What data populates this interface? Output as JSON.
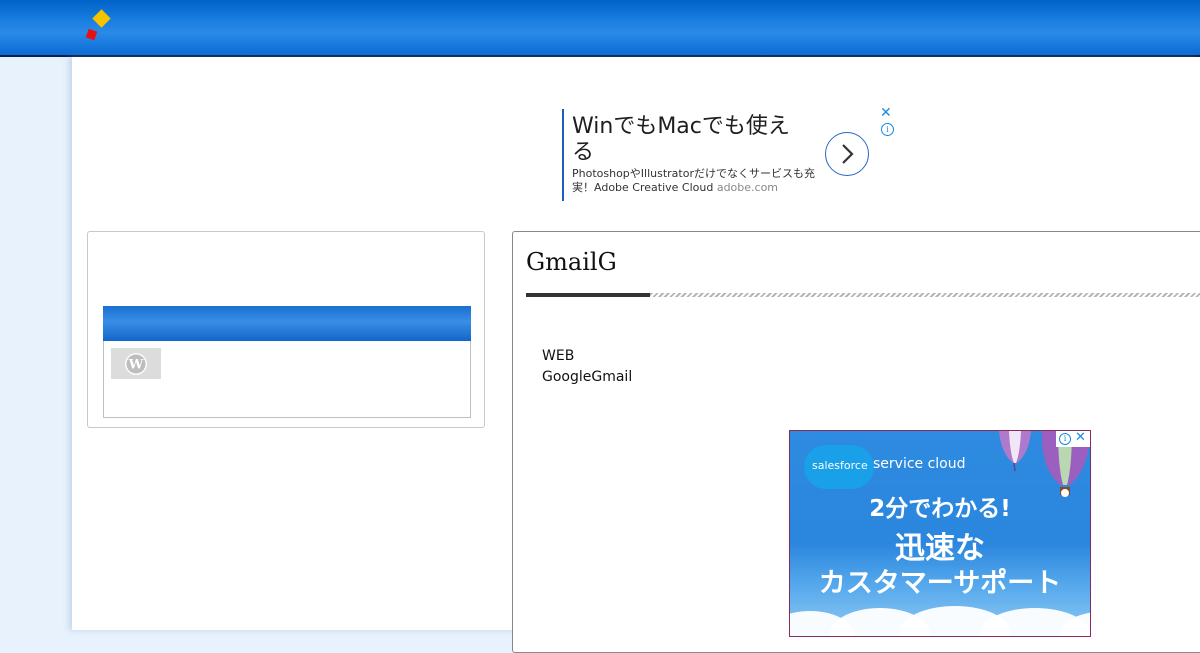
{
  "header": {
    "logo_icon": "diamond-logo-icon",
    "colors": {
      "bar": "#1a7fe0",
      "logo_yellow": "#f5c400",
      "logo_red": "#e81010"
    }
  },
  "top_ad": {
    "headline": "WinでもMacでも使える",
    "description": "PhotoshopやIllustratorだけでなくサービスも充実！Adobe Creative Cloud",
    "domain": "adobe.com",
    "close_icon": "close-icon",
    "info_icon": "info-icon",
    "arrow_icon": "chevron-right-icon",
    "close_glyph": "✕",
    "info_glyph": "i"
  },
  "sidebar": {
    "widget_icon": "wordpress-icon"
  },
  "article": {
    "title": "GmailG",
    "lines": [
      "WEB",
      "GoogleGmail"
    ]
  },
  "bottom_ad": {
    "brand": "salesforce",
    "product": "service cloud",
    "line1": "2分でわかる!",
    "line2": "迅速な",
    "line3": "カスタマーサポート",
    "info_glyph": "i",
    "close_glyph": "✕"
  }
}
